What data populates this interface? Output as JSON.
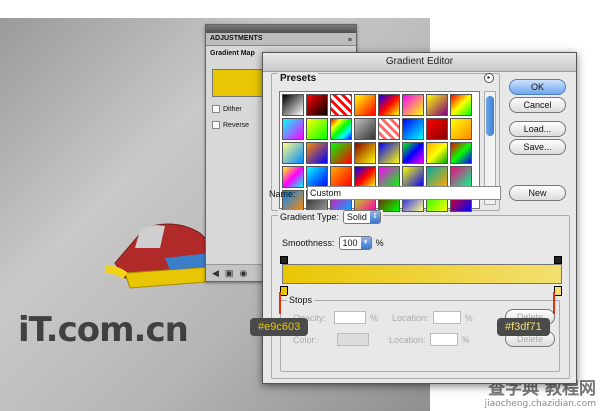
{
  "adjustments": {
    "tab_label": "ADJUSTMENTS",
    "title": "Gradient Map",
    "dither_label": "Dither",
    "reverse_label": "Reverse",
    "gradient_color": "#e9c603"
  },
  "gradient_editor": {
    "title": "Gradient Editor",
    "presets_label": "Presets",
    "buttons": {
      "ok": "OK",
      "cancel": "Cancel",
      "load": "Load...",
      "save": "Save...",
      "new": "New",
      "delete": "Delete"
    },
    "name_label": "Name:",
    "name_value": "Custom",
    "gradient_type_label": "Gradient Type:",
    "gradient_type_value": "Solid",
    "smoothness_label": "Smoothness:",
    "smoothness_value": "100",
    "smoothness_unit": "%",
    "stops_label": "Stops",
    "opacity_label": "Opacity:",
    "color_label": "Color:",
    "location_label": "Location:",
    "percent": "%",
    "start_color": "#e9c603",
    "end_color": "#f3df71"
  },
  "annotations": {
    "left_color": "#e9c603",
    "right_color": "#f3df71"
  },
  "preset_swatches": [
    "linear-gradient(135deg,#000,#fff)",
    "linear-gradient(135deg,#f00,#000)",
    "repeating-linear-gradient(45deg,#fff 0 3px,#f00 3px 6px)",
    "linear-gradient(135deg,#ff0,#f00)",
    "linear-gradient(135deg,#00f,#f00,#ff0)",
    "linear-gradient(135deg,#f0f,#ff0)",
    "linear-gradient(135deg,#ff0,#800080)",
    "linear-gradient(135deg,#f00,#ff0,#0f0)",
    "linear-gradient(135deg,#0ff,#f0f)",
    "linear-gradient(135deg,#ff0,#0f0)",
    "linear-gradient(135deg,#f00,#ff0,#0f0,#0ff,#00f)",
    "linear-gradient(135deg,#c0c0c0,#333)",
    "repeating-linear-gradient(45deg,#fff 0 3px,#f66 3px 6px)",
    "linear-gradient(135deg,#00f,#0ff)",
    "linear-gradient(135deg,#f00,#800)",
    "linear-gradient(135deg,#ff0,#f80)",
    "linear-gradient(135deg,#ff8,#08f)",
    "linear-gradient(135deg,#f80,#00f)",
    "linear-gradient(135deg,#0f0,#f00)",
    "linear-gradient(135deg,#800,#ff0)",
    "linear-gradient(135deg,#00f,#ff0)",
    "linear-gradient(135deg,#0f0,#00f,#f0f)",
    "linear-gradient(135deg,#fa0,#ff0,#0a0)",
    "linear-gradient(135deg,#f00,#0f0,#00f)",
    "linear-gradient(135deg,#ff0,#f0f,#0ff)",
    "linear-gradient(135deg,#0ff,#00f)",
    "linear-gradient(135deg,#fa0,#f00)",
    "linear-gradient(135deg,#00f,#f00,#ff0)",
    "linear-gradient(135deg,#f0f,#0f0)",
    "linear-gradient(135deg,#ff0,#00f)",
    "linear-gradient(135deg,#0aa,#fa0)",
    "linear-gradient(135deg,#f08,#0f8)",
    "linear-gradient(135deg,#08f,#f80)",
    "linear-gradient(135deg,#222,#999)",
    "linear-gradient(135deg,#f0a,#0af)",
    "linear-gradient(135deg,#af0,#f0a)",
    "linear-gradient(135deg,#800,#0f0)",
    "linear-gradient(135deg,#00f,#ff8)",
    "linear-gradient(135deg,#0f0,#ff0)",
    "linear-gradient(135deg,#f00,#00f)"
  ],
  "watermark": {
    "left": "iT.com.cn",
    "right_big": "查字典 教程网",
    "right_small": "jiaocheng.chazidian.com"
  }
}
